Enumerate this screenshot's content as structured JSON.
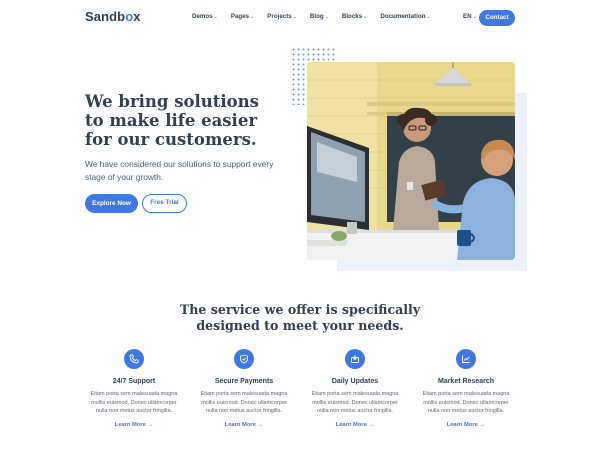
{
  "brand": {
    "logo_pre": "Sandb",
    "logo_o": "o",
    "logo_post": "x"
  },
  "nav": {
    "items": [
      {
        "label": "Demos"
      },
      {
        "label": "Pages"
      },
      {
        "label": "Projects"
      },
      {
        "label": "Blog"
      },
      {
        "label": "Blocks"
      },
      {
        "label": "Documentation"
      }
    ],
    "language": "EN",
    "contact_label": "Contact",
    "chevron_icon": "chevron-down-icon"
  },
  "hero": {
    "title": "We bring solutions to make life easier for our customers.",
    "subtitle": "We have considered our solutions to support every stage of your growth.",
    "primary_button": "Explore Now",
    "secondary_button": "Free Trial",
    "image_alt": "two people working at a computer in an office"
  },
  "services": {
    "title": "The service we offer is specifically designed to meet your needs.",
    "items": [
      {
        "icon": "phone-icon",
        "title": "24/7 Support",
        "description": "Etiam porta sem malesuada magna mollis euismod. Donec ullamcorper nulla non metus auctor fringilla.",
        "link": "Learn More"
      },
      {
        "icon": "shield-icon",
        "title": "Secure Payments",
        "description": "Etiam porta sem malesuada magna mollis euismod. Donec ullamcorper nulla non metus auctor fringilla.",
        "link": "Learn More"
      },
      {
        "icon": "update-icon",
        "title": "Daily Updates",
        "description": "Etiam porta sem malesuada magna mollis euismod. Donec ullamcorper nulla non metus auctor fringilla.",
        "link": "Learn More"
      },
      {
        "icon": "chart-icon",
        "title": "Market Research",
        "description": "Etiam porta sem malesuada magna mollis euismod. Donec ullamcorper nulla non metus auctor fringilla.",
        "link": "Learn More"
      }
    ],
    "link_arrow": "→"
  },
  "colors": {
    "accent": "#3f78e0",
    "heading": "#343f52",
    "body": "#60697b"
  }
}
